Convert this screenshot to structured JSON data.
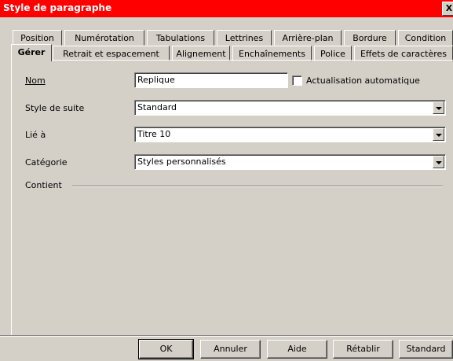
{
  "dialog": {
    "title": "Style de paragraphe",
    "close_glyph": "X"
  },
  "tabs_row1": [
    {
      "label": "Position"
    },
    {
      "label": "Numérotation"
    },
    {
      "label": "Tabulations"
    },
    {
      "label": "Lettrines"
    },
    {
      "label": "Arrière-plan"
    },
    {
      "label": "Bordure"
    },
    {
      "label": "Condition"
    }
  ],
  "tabs_row2": [
    {
      "label": "Gérer",
      "active": true
    },
    {
      "label": "Retrait et espacement"
    },
    {
      "label": "Alignement"
    },
    {
      "label": "Enchaînements"
    },
    {
      "label": "Police"
    },
    {
      "label": "Effets de caractères"
    }
  ],
  "form": {
    "nom_label": "Nom",
    "nom_value": "Replique",
    "autoupdate_label": "Actualisation automatique",
    "autoupdate_checked": false,
    "style_suite_label": "Style de suite",
    "style_suite_value": "Standard",
    "lie_label": "Lié à",
    "lie_value": "Titre 10",
    "categorie_label": "Catégorie",
    "categorie_value": "Styles personnalisés",
    "contient_label": "Contient"
  },
  "buttons": {
    "ok": "OK",
    "annuler": "Annuler",
    "aide": "Aide",
    "retablir": "Rétablir",
    "standard": "Standard"
  },
  "colors": {
    "titlebar": "#ff0000",
    "face": "#d4d0c8"
  }
}
